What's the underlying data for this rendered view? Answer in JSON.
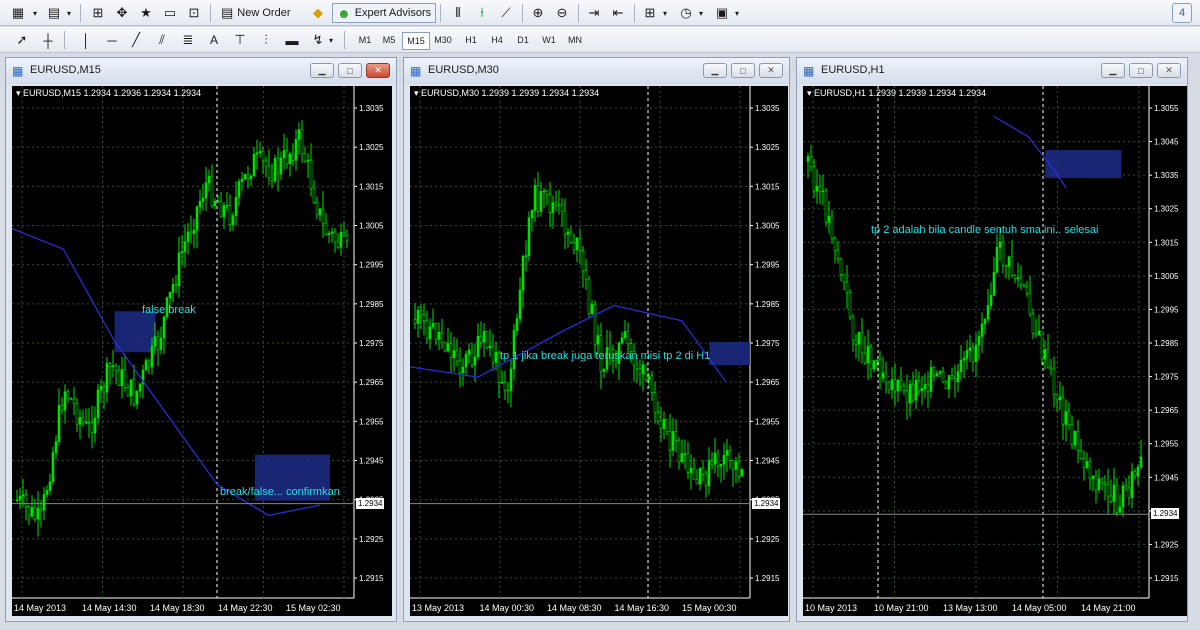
{
  "toolbar": {
    "new_order_label": "New Order",
    "expert_advisors_label": "Expert Advisors",
    "timeframes": [
      "M1",
      "M5",
      "M15",
      "M30",
      "H1",
      "H4",
      "D1",
      "W1",
      "MN"
    ],
    "active_timeframe": "M15",
    "badge_label": "4"
  },
  "windows": [
    {
      "title": "EURUSD,M15",
      "header": "EURUSD,M15  1.2934 1.2936 1.2934 1.2934",
      "prices": [
        "1.3035",
        "1.3025",
        "1.3015",
        "1.3005",
        "1.2995",
        "1.2985",
        "1.2975",
        "1.2965",
        "1.2955",
        "1.2945",
        "1.2935",
        "1.2925",
        "1.2915"
      ],
      "current_price": "1.2934",
      "time_labels": [
        "14 May 2013",
        "14 May 14:30",
        "14 May 18:30",
        "14 May 22:30",
        "15 May 02:30"
      ],
      "annotations": [
        "false break",
        "break/false... confirmkan"
      ]
    },
    {
      "title": "EURUSD,M30",
      "header": "EURUSD,M30  1.2939 1.2939 1.2934 1.2934",
      "prices": [
        "1.3035",
        "1.3025",
        "1.3015",
        "1.3005",
        "1.2995",
        "1.2985",
        "1.2975",
        "1.2965",
        "1.2955",
        "1.2945",
        "1.2935",
        "1.2925",
        "1.2915"
      ],
      "current_price": "1.2934",
      "time_labels": [
        "13 May 2013",
        "14 May 00:30",
        "14 May 08:30",
        "14 May 16:30",
        "15 May 00:30"
      ],
      "annotations": [
        "tp 1 jika break juga teruskan misi tp 2 di H1"
      ]
    },
    {
      "title": "EURUSD,H1",
      "header": "EURUSD,H1  1.2939 1.2939 1.2934 1.2934",
      "prices": [
        "1.3055",
        "1.3045",
        "1.3035",
        "1.3025",
        "1.3015",
        "1.3005",
        "1.2995",
        "1.2985",
        "1.2975",
        "1.2965",
        "1.2955",
        "1.2945",
        "1.2935",
        "1.2925",
        "1.2915"
      ],
      "current_price": "1.2934",
      "time_labels": [
        "10 May 2013",
        "10 May 21:00",
        "13 May 13:00",
        "14 May 05:00",
        "14 May 21:00"
      ],
      "annotations": [
        "tp 2 adalah bila candle sentuh sma ini.. selesai"
      ]
    }
  ],
  "colors": {
    "bull": "#00e000",
    "bear": "#00e000",
    "ma": "#2b2bd8",
    "zone": "#1c2a80",
    "annotation": "#1ee0e6"
  }
}
